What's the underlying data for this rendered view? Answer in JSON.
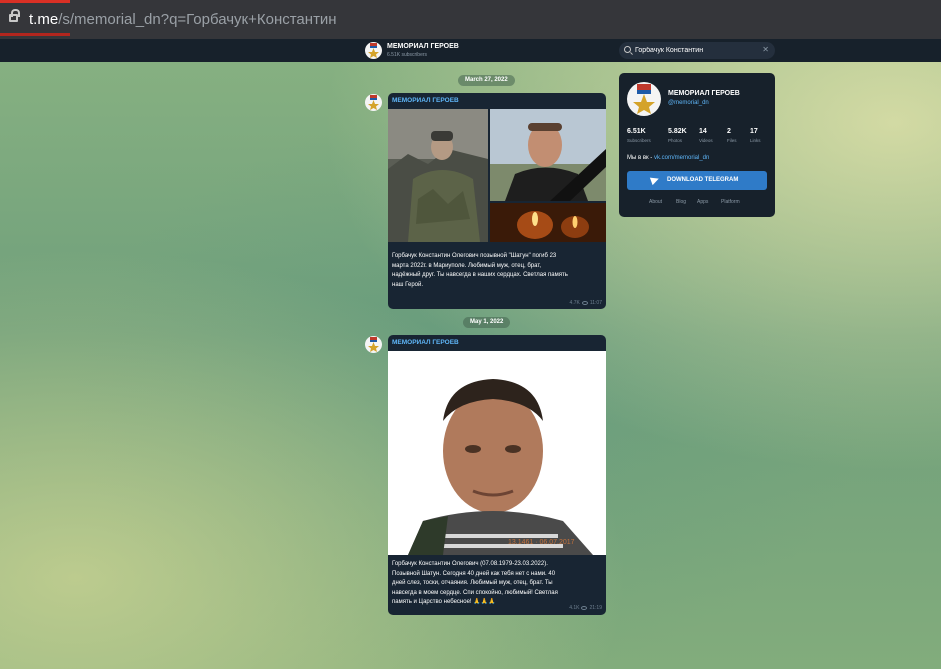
{
  "browser": {
    "url_host": "t.me",
    "url_rest": "/s/memorial_dn?q=Горбачук+Константин"
  },
  "header": {
    "channel_title": "МЕМОРИАЛ ГЕРОЕВ",
    "channel_subscribers": "6.51K subscribers",
    "search_value": "Горбачук Константин"
  },
  "feed": {
    "date_1": "March 27, 2022",
    "date_2": "May 1, 2022",
    "posts": [
      {
        "author": "МЕМОРИАЛ ГЕРОЕВ",
        "text_lines": [
          "Горбачук Константин Олегович позывной \"Шатун\" погиб 23",
          "марта 2022г. в Мариуполе. Любимый муж, отец, брат,",
          "надёжный друг. Ты навсегда в наших сердцах. Светлая память",
          "наш Герой."
        ],
        "views": "4.7K",
        "time": "11:07"
      },
      {
        "author": "МЕМОРИАЛ ГЕРОЕВ",
        "photo_stamp": "13.1461 · 06.07.2017",
        "text_lines": [
          "Горбачук Константин Олегович (07.08.1979-23.03.2022).",
          "Позывной Шатун. Сегодня 40 дней как тебя нет с нами. 40",
          "дней слез, тоски, отчаяния. Любимый муж, отец, брат. Ты",
          "навсегда в моем сердце. Спи спокойно, любимый! Светлая",
          "память и Царство небесное! 🙏🙏🙏"
        ],
        "views": "4.1K",
        "time": "21:19"
      }
    ]
  },
  "sidebar": {
    "title": "МЕМОРИАЛ ГЕРОЕВ",
    "username": "@memorial_dn",
    "stats": [
      {
        "value": "6.51K",
        "label": "Subscribers"
      },
      {
        "value": "5.82K",
        "label": "Photos"
      },
      {
        "value": "14",
        "label": "Videos"
      },
      {
        "value": "2",
        "label": "Files"
      },
      {
        "value": "17",
        "label": "Links"
      }
    ],
    "desc_prefix": "Мы в вк - ",
    "desc_link": "vk.com/memorial_dn",
    "download_label": "DOWNLOAD TELEGRAM",
    "footer_links": [
      "About",
      "Blog",
      "Apps",
      "Platform"
    ]
  },
  "colors": {
    "accent": "#5eb5f7",
    "button": "#2f7bc8",
    "bubble": "#182533"
  }
}
